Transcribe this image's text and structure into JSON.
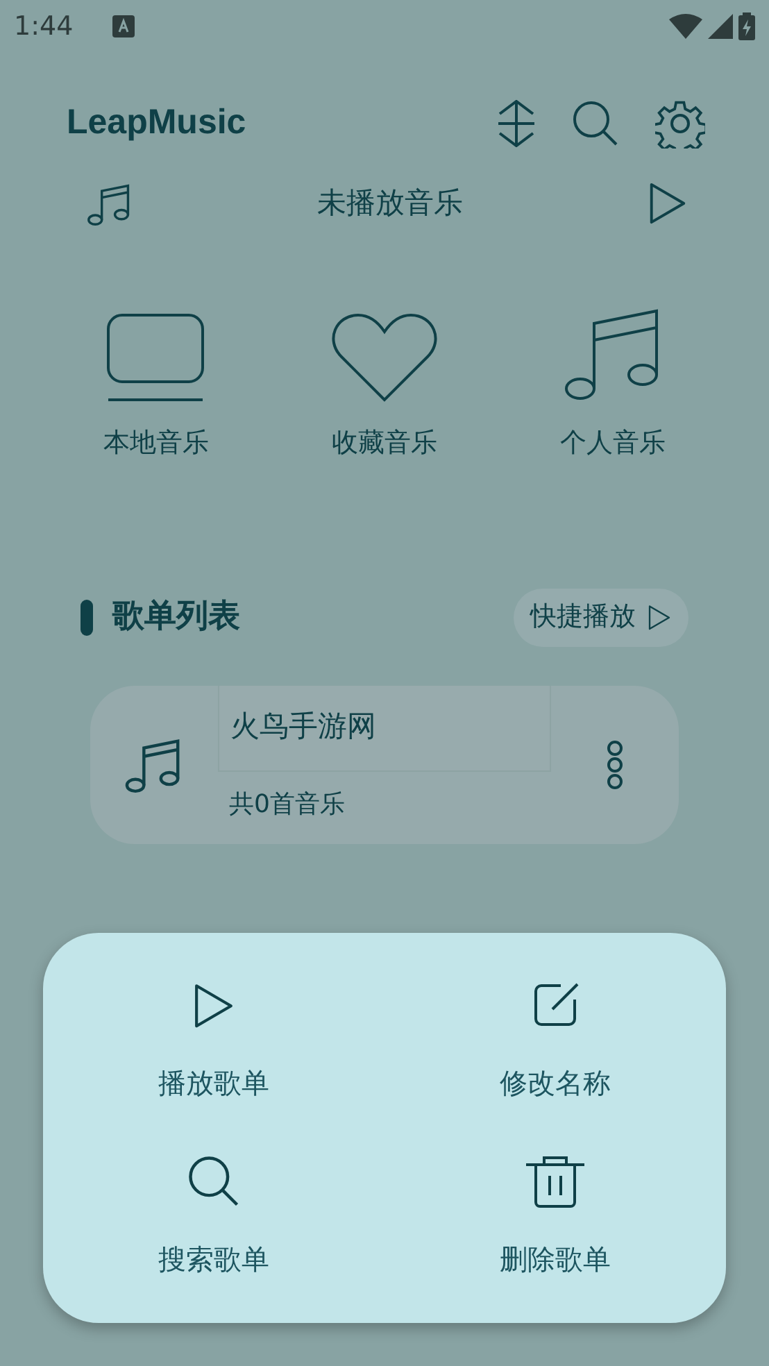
{
  "status_bar": {
    "time": "1:44"
  },
  "header": {
    "title": "LeapMusic"
  },
  "now_playing": {
    "text": "未播放音乐"
  },
  "categories": [
    {
      "kind": "local",
      "label": "本地音乐"
    },
    {
      "kind": "favorite",
      "label": "收藏音乐"
    },
    {
      "kind": "personal",
      "label": "个人音乐"
    }
  ],
  "playlist_section": {
    "title": "歌单列表",
    "quick_play": "快捷播放"
  },
  "playlists": [
    {
      "name": "火鸟手游网",
      "count": "共0首音乐"
    }
  ],
  "action_sheet": [
    {
      "kind": "play",
      "label": "播放歌单"
    },
    {
      "kind": "edit",
      "label": "修改名称"
    },
    {
      "kind": "search",
      "label": "搜索歌单"
    },
    {
      "kind": "delete",
      "label": "删除歌单"
    }
  ]
}
